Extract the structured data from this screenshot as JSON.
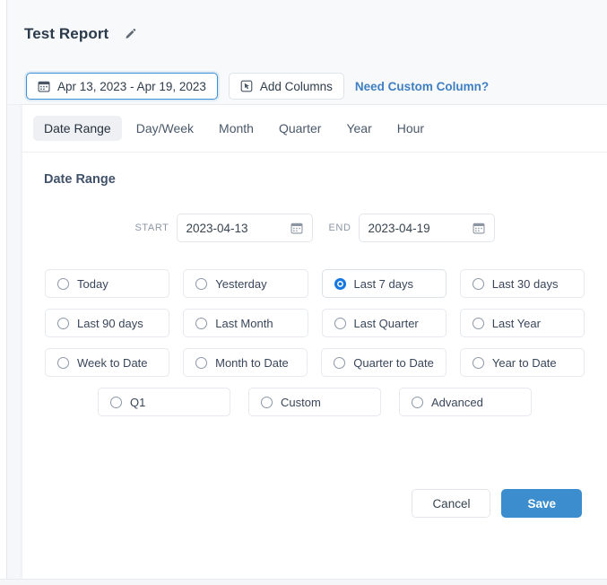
{
  "header": {
    "title": "Test Report",
    "edit_icon": "pencil-icon",
    "date_pill": {
      "icon": "calendar-icon",
      "label": "Apr 13, 2023 - Apr 19, 2023"
    },
    "add_columns": {
      "icon": "add-columns-icon",
      "label": "Add Columns"
    },
    "need_custom_column": {
      "label": "Need Custom Column?",
      "color": "#3f7fc1"
    }
  },
  "tabs": [
    {
      "label": "Date Range",
      "active": true
    },
    {
      "label": "Day/Week",
      "active": false
    },
    {
      "label": "Month",
      "active": false
    },
    {
      "label": "Quarter",
      "active": false
    },
    {
      "label": "Year",
      "active": false
    },
    {
      "label": "Hour",
      "active": false
    }
  ],
  "panel": {
    "section_title": "Date Range",
    "fields": {
      "start": {
        "label": "START",
        "value": "2023-04-13",
        "icon": "calendar-icon"
      },
      "end": {
        "label": "END",
        "value": "2023-04-19",
        "icon": "calendar-icon"
      }
    },
    "options_rows": [
      [
        {
          "label": "Today",
          "selected": false
        },
        {
          "label": "Yesterday",
          "selected": false
        },
        {
          "label": "Last 7 days",
          "selected": true
        },
        {
          "label": "Last 30 days",
          "selected": false
        }
      ],
      [
        {
          "label": "Last 90 days",
          "selected": false
        },
        {
          "label": "Last Month",
          "selected": false
        },
        {
          "label": "Last Quarter",
          "selected": false
        },
        {
          "label": "Last Year",
          "selected": false
        }
      ],
      [
        {
          "label": "Week to Date",
          "selected": false
        },
        {
          "label": "Month to Date",
          "selected": false
        },
        {
          "label": "Quarter to Date",
          "selected": false
        },
        {
          "label": "Year to Date",
          "selected": false
        }
      ],
      [
        {
          "label": "Q1",
          "selected": false
        },
        {
          "label": "Custom",
          "selected": false
        },
        {
          "label": "Advanced",
          "selected": false
        }
      ]
    ],
    "footer": {
      "cancel_label": "Cancel",
      "save_label": "Save",
      "save_color": "#3c8dcd"
    }
  },
  "colors": {
    "accent": "#1777e0",
    "link": "#3f7fc1",
    "primary_button": "#3c8dcd",
    "focus_border": "#3b8fd4"
  }
}
